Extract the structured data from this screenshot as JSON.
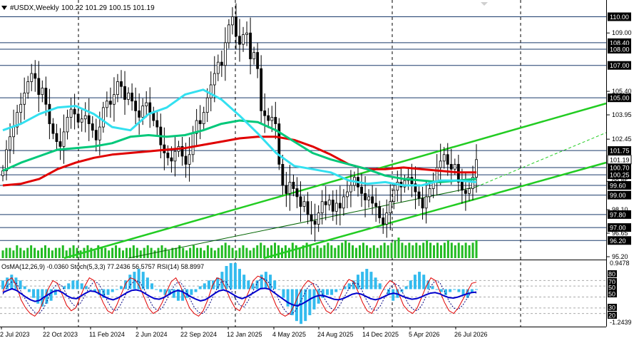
{
  "header": {
    "symbol": "#USDX,Weekly",
    "ohlc": "100.22 101.29 100.15 101.19",
    "indicator_line": "OsMA(12,26,9) -0.0360  Stoch(5,3,3) 77.2436 56.5757  RSI(14) 58.8997"
  },
  "colors": {
    "background": "#ffffff",
    "candle": "#000000",
    "ma_slow": "#e00000",
    "ma_mid": "#00c87a",
    "ma_fast": "#33e0f0",
    "channel": "#22cc22",
    "trend_thin": "#006400",
    "volume": "#22bb22",
    "osma": "#33bbee",
    "stoch_main": "#e00000",
    "stoch_signal": "#000080",
    "rsi": "#0000cc",
    "level_line": "#1a3a6a",
    "price_badge": "#000000"
  },
  "price_axis": {
    "plain_ticks": [
      "109.00",
      "105.40",
      "103.95",
      "102.45",
      "99.85",
      "98.10",
      "96.65",
      "95.20"
    ],
    "level_badges": [
      "110.00",
      "108.40",
      "108.00",
      "107.00",
      "105.00",
      "101.75",
      "100.70",
      "100.25",
      "99.60",
      "99.00",
      "97.80",
      "97.00",
      "96.20"
    ],
    "current_badge": "101.19"
  },
  "indicator_axis": {
    "top_value": "0.9478",
    "bottom_value": "-1.2439",
    "ticks": [
      "80",
      "70",
      "50",
      "50",
      "30",
      "20"
    ]
  },
  "time_axis": {
    "labels": [
      "2 Jul 2023",
      "22 Oct 2023",
      "11 Feb 2024",
      "2 Jun 2024",
      "22 Sep 2024",
      "12 Jan 2025",
      "4 May 2025",
      "24 Aug 2025",
      "14 Dec 2025",
      "5 Apr 2026",
      "26 Jul 2026"
    ]
  },
  "chart_data": {
    "type": "candlestick",
    "ylim": [
      95.2,
      110.6
    ],
    "levels": [
      110.0,
      108.4,
      108.0,
      107.0,
      105.0,
      101.75,
      100.7,
      100.25,
      99.6,
      99.0,
      97.8,
      97.0,
      96.2
    ],
    "weekly_close_approx": [
      100.5,
      101.8,
      102.6,
      103.2,
      104.1,
      104.6,
      105.3,
      106.0,
      106.5,
      106.2,
      105.2,
      105.6,
      104.6,
      103.4,
      102.8,
      102.3,
      102.0,
      102.9,
      103.8,
      104.3,
      104.0,
      103.5,
      103.7,
      103.9,
      103.4,
      103.0,
      102.4,
      103.2,
      104.4,
      104.8,
      104.6,
      105.2,
      106.0,
      105.7,
      104.9,
      105.3,
      104.8,
      104.2,
      103.8,
      104.5,
      104.7,
      104.1,
      103.6,
      103.2,
      102.1,
      101.6,
      101.3,
      101.1,
      101.7,
      102.0,
      101.4,
      100.9,
      101.5,
      102.8,
      103.6,
      103.4,
      104.1,
      105.0,
      105.8,
      106.5,
      107.2,
      107.0,
      108.4,
      109.5,
      110.0,
      108.8,
      108.3,
      108.9,
      109.0,
      107.4,
      107.8,
      106.8,
      104.2,
      103.9,
      103.6,
      103.8,
      103.4,
      100.9,
      99.6,
      99.1,
      99.8,
      99.4,
      98.9,
      98.3,
      98.6,
      97.8,
      97.4,
      97.2,
      97.9,
      98.6,
      98.4,
      98.7,
      98.0,
      98.5,
      98.2,
      98.9,
      99.2,
      99.6,
      100.1,
      99.5,
      99.1,
      98.7,
      98.9,
      98.5,
      98.3,
      97.6,
      97.2,
      97.9,
      98.6,
      99.3,
      99.8,
      99.5,
      99.9,
      100.1,
      99.7,
      99.2,
      98.8,
      98.2,
      98.9,
      99.4,
      99.8,
      100.7,
      101.1,
      101.5,
      100.9,
      100.6,
      100.9,
      99.8,
      99.3,
      99.1,
      99.4,
      100.1,
      101.19
    ],
    "ma_slow_approx": [
      99.6,
      99.7,
      100.0,
      100.6,
      101.0,
      101.3,
      101.5,
      101.6,
      101.7,
      101.8,
      101.9,
      102.1,
      102.3,
      102.5,
      102.6,
      102.6,
      102.4,
      102.0,
      101.5,
      100.9,
      100.6,
      100.6,
      100.7,
      100.6,
      100.5,
      100.4,
      100.4
    ],
    "ma_mid_approx": [
      100.5,
      101.0,
      101.4,
      101.8,
      101.9,
      102.0,
      102.2,
      102.6,
      102.7,
      102.6,
      102.7,
      103.0,
      103.4,
      103.6,
      103.5,
      103.0,
      102.3,
      101.6,
      101.2,
      100.9,
      100.6,
      100.2,
      100.0,
      99.9,
      99.8,
      99.9,
      100.0
    ],
    "ma_fast_approx": [
      103.0,
      103.4,
      104.0,
      104.4,
      104.5,
      104.0,
      103.2,
      103.0,
      104.0,
      104.4,
      105.2,
      105.5,
      104.9,
      103.9,
      102.8,
      101.6,
      100.8,
      100.6,
      100.4,
      99.9,
      99.7,
      99.8,
      99.6,
      99.6,
      99.9,
      99.9,
      99.8
    ],
    "volume_approx": [
      3,
      4,
      4,
      3,
      5,
      4,
      3,
      4,
      5,
      4,
      3,
      4,
      5,
      4,
      3,
      4,
      4,
      5,
      3,
      4,
      5,
      4,
      3,
      4,
      5,
      4,
      3,
      5,
      4,
      4,
      3,
      4,
      5,
      4,
      3,
      4,
      4,
      5,
      4,
      3,
      4,
      5,
      4,
      3,
      4,
      5,
      4,
      3,
      4,
      4,
      5,
      4,
      3,
      4,
      5,
      4,
      4,
      3,
      5,
      4,
      3,
      4,
      5,
      6,
      5,
      4,
      3,
      4,
      5,
      4,
      3,
      4,
      5,
      6,
      5,
      4,
      5,
      6,
      5,
      4,
      5,
      4,
      6,
      5,
      4,
      5,
      6,
      5,
      4,
      5,
      4,
      5,
      6,
      5,
      4,
      5,
      6,
      7,
      6,
      5,
      4,
      5,
      6,
      5,
      4,
      5,
      4,
      5,
      6,
      5,
      6,
      7,
      8,
      6,
      5,
      6,
      5,
      6,
      5,
      6,
      7,
      6,
      5,
      6,
      5,
      6,
      7,
      6,
      5,
      6,
      5,
      6,
      5,
      6,
      7
    ],
    "osma_approx": [
      0.3,
      0.4,
      0.5,
      0.4,
      0.3,
      0.1,
      -0.1,
      -0.3,
      -0.5,
      -0.6,
      -0.5,
      -0.4,
      -0.2,
      0.0,
      0.1,
      0.2,
      0.3,
      0.3,
      0.2,
      0.1,
      0.0,
      -0.1,
      -0.2,
      -0.3,
      -0.2,
      -0.1,
      0.0,
      0.1,
      0.3,
      0.5,
      0.6,
      0.7,
      0.6,
      0.4,
      0.2,
      0.0,
      -0.1,
      -0.2,
      -0.2,
      -0.3,
      -0.4,
      -0.4,
      -0.3,
      -0.2,
      -0.1,
      0.1,
      0.2,
      0.3,
      0.3,
      0.4,
      0.6,
      0.8,
      0.9,
      0.9,
      0.7,
      0.5,
      0.3,
      0.2,
      0.3,
      0.5,
      0.6,
      0.5,
      0.3,
      0.0,
      -0.3,
      -0.6,
      -0.9,
      -1.1,
      -1.2,
      -1.1,
      -0.9,
      -0.7,
      -0.5,
      -0.3,
      -0.2,
      -0.2,
      -0.1,
      0.0,
      0.1,
      0.2,
      0.3,
      0.5,
      0.6,
      0.7,
      0.6,
      0.4,
      0.2,
      0.0,
      -0.2,
      -0.4,
      -0.3,
      -0.1,
      0.1,
      0.3,
      0.5,
      0.6,
      0.5,
      0.3,
      0.1,
      0.0,
      -0.1,
      -0.2,
      -0.1,
      0.0,
      -0.1,
      -0.2,
      -0.3,
      -0.1,
      0.0
    ],
    "stoch_main_approx": [
      60,
      80,
      85,
      70,
      45,
      30,
      20,
      15,
      25,
      45,
      65,
      80,
      75,
      55,
      35,
      25,
      30,
      50,
      70,
      85,
      80,
      60,
      40,
      25,
      20,
      35,
      55,
      75,
      85,
      82,
      70,
      50,
      30,
      20,
      25,
      40,
      60,
      78,
      85,
      70,
      50,
      30,
      20,
      15,
      25,
      45,
      70,
      85,
      82,
      65,
      45,
      30,
      25,
      40,
      60,
      80,
      88,
      85,
      75,
      55,
      35,
      20,
      15,
      20,
      35,
      55,
      70,
      80,
      75,
      60,
      40,
      25,
      20,
      30,
      50,
      70,
      82,
      78,
      60,
      40,
      25,
      20,
      35,
      55,
      70,
      80,
      75,
      55,
      35,
      25,
      20,
      30,
      50,
      70,
      85,
      80,
      60,
      40,
      25,
      20,
      30,
      45,
      60,
      75,
      77
    ],
    "stoch_signal_approx": [
      55,
      70,
      78,
      75,
      60,
      45,
      32,
      22,
      20,
      30,
      48,
      65,
      75,
      70,
      55,
      40,
      32,
      38,
      52,
      68,
      78,
      75,
      60,
      42,
      28,
      25,
      38,
      55,
      72,
      80,
      78,
      65,
      48,
      32,
      25,
      30,
      45,
      62,
      75,
      77,
      65,
      48,
      32,
      22,
      20,
      30,
      48,
      65,
      78,
      78,
      65,
      48,
      35,
      32,
      45,
      62,
      78,
      85,
      80,
      70,
      55,
      38,
      25,
      18,
      22,
      35,
      52,
      68,
      75,
      72,
      58,
      42,
      30,
      25,
      35,
      50,
      65,
      76,
      74,
      60,
      42,
      28,
      25,
      35,
      52,
      66,
      75,
      70,
      55,
      38,
      28,
      25,
      35,
      52,
      70,
      80,
      76,
      60,
      42,
      30,
      27,
      35,
      48,
      60,
      57
    ],
    "rsi_approx": [
      58,
      62,
      65,
      62,
      56,
      50,
      45,
      42,
      44,
      50,
      55,
      60,
      62,
      58,
      52,
      48,
      47,
      52,
      57,
      61,
      60,
      56,
      51,
      47,
      45,
      48,
      53,
      58,
      62,
      63,
      61,
      56,
      51,
      47,
      46,
      49,
      54,
      59,
      62,
      60,
      55,
      50,
      46,
      43,
      45,
      50,
      56,
      61,
      63,
      60,
      55,
      50,
      47,
      50,
      55,
      60,
      65,
      66,
      64,
      58,
      52,
      46,
      40,
      36,
      34,
      37,
      42,
      47,
      51,
      53,
      52,
      49,
      46,
      45,
      47,
      51,
      55,
      57,
      55,
      51,
      47,
      45,
      47,
      51,
      55,
      57,
      55,
      51,
      48,
      46,
      47,
      50,
      54,
      57,
      58,
      56,
      52,
      49,
      48,
      50,
      53,
      56,
      58,
      59
    ]
  }
}
